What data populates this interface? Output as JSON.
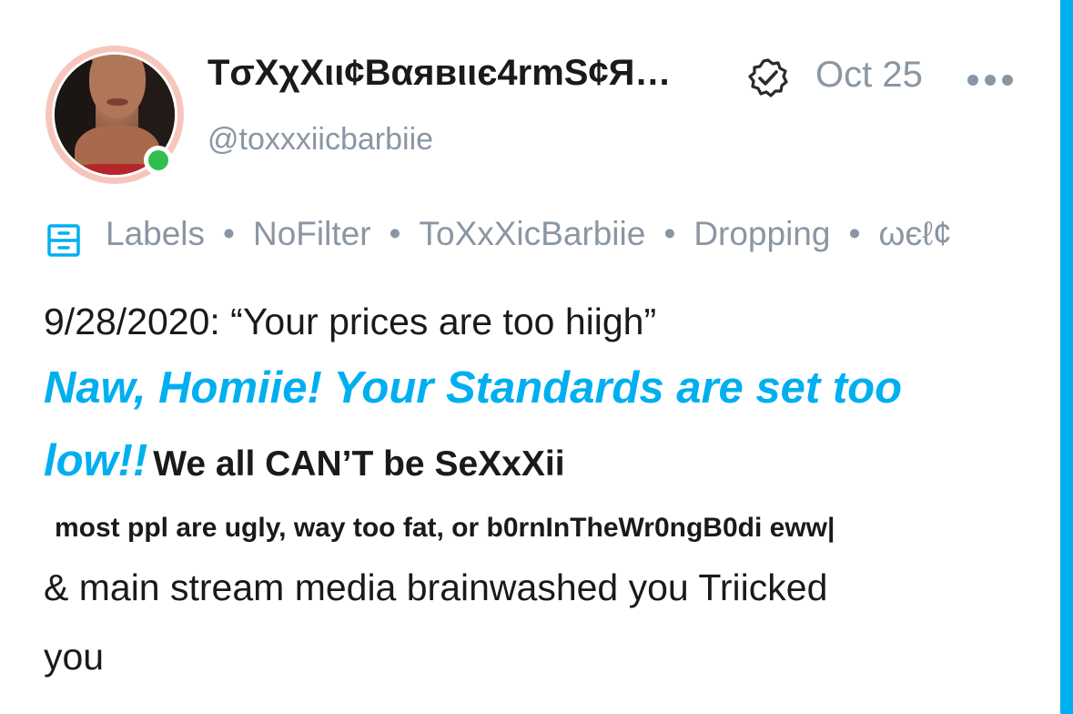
{
  "post": {
    "author": {
      "display_name": "ТσХχХιι¢Вαявιιє4rmЅ¢Я…",
      "handle": "@toxxxiicbarbiie",
      "verified": true,
      "online": true
    },
    "date": "Oct 25",
    "labels": [
      "Labels",
      "NoFilter",
      "ToXxXicBarbiie",
      "Dropping",
      "ωєℓ¢"
    ],
    "label_separator": "•",
    "body": {
      "line1": "9/28/2020: “Your prices are too hiigh”",
      "accent_part1": "Naw, Homiie! Your Standards are set too",
      "accent_part2": "low!!",
      "bold_after_accent": "We all CAN’T be SeXxXii",
      "small_bold": "most ppl are ugly, way too fat, or b0rnInTheWr0ngB0di eww|",
      "line5": "& main stream media brainwashed you Triicked",
      "line6": "you"
    }
  },
  "colors": {
    "accent": "#00aff0",
    "muted": "#8a96a3",
    "online": "#2fbf4e",
    "avatar_ring": "#f6c6bd"
  },
  "icons": {
    "verified": "verified-check-icon",
    "more": "more-dots-icon",
    "labels": "labels-drawer-icon"
  }
}
